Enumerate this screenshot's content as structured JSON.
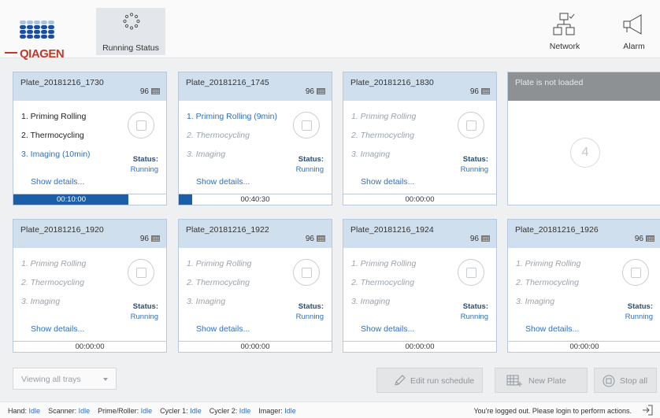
{
  "header": {
    "logo_text": "QIAGEN",
    "tab_running_status": "Running Status",
    "network_label": "Network",
    "alarm_label": "Alarm"
  },
  "trays": [
    {
      "name": "Plate_20181216_1730",
      "wells": "96",
      "steps": [
        {
          "label": "1. Priming Rolling",
          "state": "done"
        },
        {
          "label": "2. Thermocycling",
          "state": "done"
        },
        {
          "label": "3. Imaging (10min)",
          "state": "active"
        }
      ],
      "status_label": "Status:",
      "status_value": "Running",
      "details": "Show details...",
      "time": "00:10:00",
      "progress": 0.75
    },
    {
      "name": "Plate_20181216_1745",
      "wells": "96",
      "steps": [
        {
          "label": "1. Priming Rolling (9min)",
          "state": "active"
        },
        {
          "label": "2. Thermocycling",
          "state": "pending"
        },
        {
          "label": "3. Imaging",
          "state": "pending"
        }
      ],
      "status_label": "Status:",
      "status_value": "Running",
      "details": "Show details...",
      "time": "00:40:30",
      "progress": 0.09
    },
    {
      "name": "Plate_20181216_1830",
      "wells": "96",
      "steps": [
        {
          "label": "1. Priming Rolling",
          "state": "pending"
        },
        {
          "label": "2. Thermocycling",
          "state": "pending"
        },
        {
          "label": "3. Imaging",
          "state": "pending"
        }
      ],
      "status_label": "Status:",
      "status_value": "Running",
      "details": "Show details...",
      "time": "00:00:00",
      "progress": 0
    },
    {
      "empty": true,
      "name": "Plate is not loaded",
      "number": "4"
    },
    {
      "name": "Plate_20181216_1920",
      "wells": "96",
      "steps": [
        {
          "label": "1. Priming Rolling",
          "state": "pending"
        },
        {
          "label": "2. Thermocycling",
          "state": "pending"
        },
        {
          "label": "3. Imaging",
          "state": "pending"
        }
      ],
      "status_label": "Status:",
      "status_value": "Running",
      "details": "Show details...",
      "time": "00:00:00",
      "progress": 0
    },
    {
      "name": "Plate_20181216_1922",
      "wells": "96",
      "steps": [
        {
          "label": "1. Priming Rolling",
          "state": "pending"
        },
        {
          "label": "2. Thermocycling",
          "state": "pending"
        },
        {
          "label": "3. Imaging",
          "state": "pending"
        }
      ],
      "status_label": "Status:",
      "status_value": "Running",
      "details": "Show details...",
      "time": "00:00:00",
      "progress": 0
    },
    {
      "name": "Plate_20181216_1924",
      "wells": "96",
      "steps": [
        {
          "label": "1. Priming Rolling",
          "state": "pending"
        },
        {
          "label": "2. Thermocycling",
          "state": "pending"
        },
        {
          "label": "3. Imaging",
          "state": "pending"
        }
      ],
      "status_label": "Status:",
      "status_value": "Running",
      "details": "Show details...",
      "time": "00:00:00",
      "progress": 0
    },
    {
      "name": "Plate_20181216_1926",
      "wells": "96",
      "steps": [
        {
          "label": "1. Priming Rolling",
          "state": "pending"
        },
        {
          "label": "2. Thermocycling",
          "state": "pending"
        },
        {
          "label": "3. Imaging",
          "state": "pending"
        }
      ],
      "status_label": "Status:",
      "status_value": "Running",
      "details": "Show details...",
      "time": "00:00:00",
      "progress": 0
    }
  ],
  "actions": {
    "view_select": "Viewing all trays",
    "edit_schedule": "Edit run schedule",
    "new_plate": "New Plate",
    "stop_all": "Stop all"
  },
  "statusbar": {
    "items": [
      {
        "key": "Hand:",
        "value": "Idle"
      },
      {
        "key": "Scanner:",
        "value": "Idle"
      },
      {
        "key": "Prime/Roller:",
        "value": "Idle"
      },
      {
        "key": "Cycler 1:",
        "value": "Idle"
      },
      {
        "key": "Cycler 2:",
        "value": "Idle"
      },
      {
        "key": "Imager:",
        "value": "Idle"
      }
    ],
    "message": "You're logged out. Please login to perform actions."
  },
  "colors": {
    "accent": "#2f6fbf",
    "progress": "#1d5ea8",
    "tray_header": "#cfdfee",
    "empty_header": "#8e9194",
    "brand_red": "#c0392b"
  }
}
